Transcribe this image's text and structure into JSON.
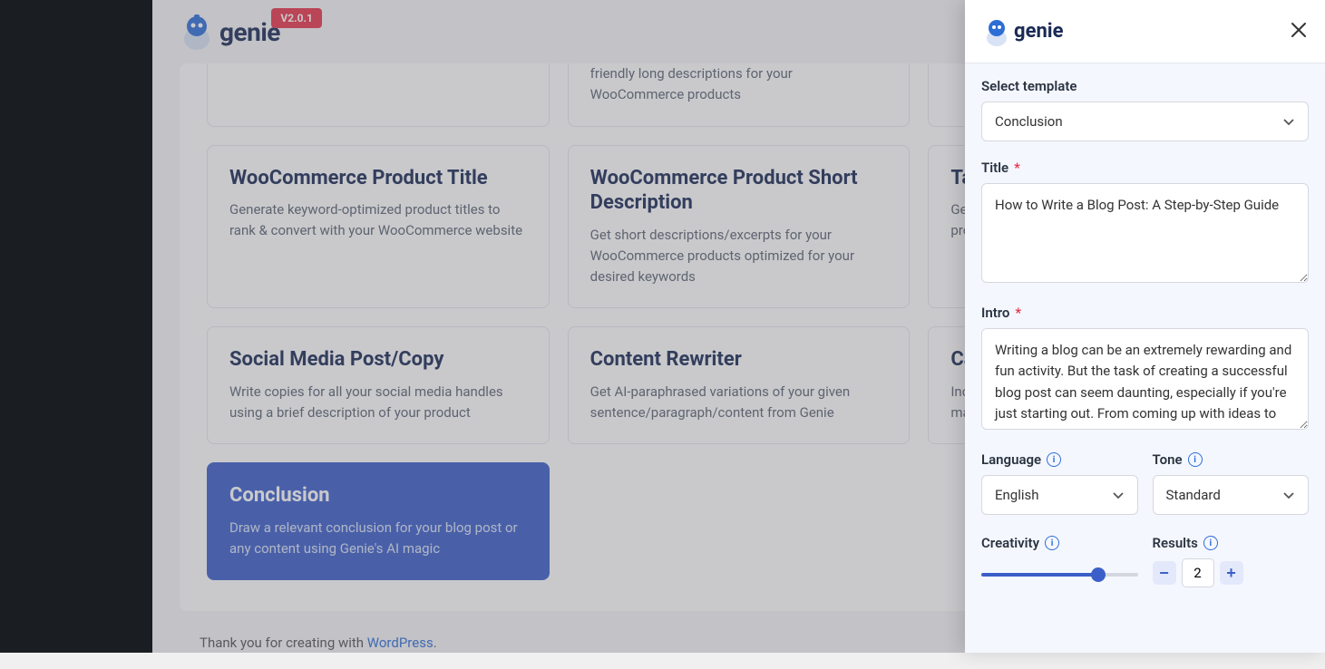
{
  "header": {
    "brand": "genie",
    "version": "V2.0.1"
  },
  "cards": {
    "row0": {
      "col1_desc": "friendly long descriptions for your WooCommerce products"
    },
    "row1": {
      "c0": {
        "title": "WooCommerce Product Title",
        "desc": "Generate keyword-optimized product titles to rank & convert with your WooCommerce website"
      },
      "c1": {
        "title": "WooCommerce Product Short Description",
        "desc": "Get short descriptions/excerpts for your WooCommerce products optimized for your desired keywords"
      },
      "c2": {
        "title_partial": "Tag",
        "desc_partial": "Get\nprod"
      }
    },
    "row2": {
      "c0": {
        "title": "Social Media Post/Copy",
        "desc": "Write copies for all your social media handles using a brief description of your product"
      },
      "c1": {
        "title": "Content Rewriter",
        "desc": "Get AI-paraphrased variations of your given sentence/paragraph/content from Genie"
      },
      "c2": {
        "title_partial": "Ca",
        "desc_partial": "Incr\nmag"
      }
    },
    "row3": {
      "c0": {
        "title": "Conclusion",
        "desc": "Draw a relevant conclusion for your blog post or any content using Genie's AI magic"
      }
    }
  },
  "footer": {
    "prefix": "Thank you for creating with ",
    "link": "WordPress",
    "suffix": "."
  },
  "panel": {
    "select_template_label": "Select template",
    "select_template_value": "Conclusion",
    "title_label": "Title",
    "title_value": "How to Write a Blog Post: A Step-by-Step Guide",
    "intro_label": "Intro",
    "intro_value": "Writing a blog can be an extremely rewarding and fun activity. But the task of creating a successful blog post can seem daunting, especially if you're just starting out. From coming up with ideas to",
    "language_label": "Language",
    "language_value": "English",
    "tone_label": "Tone",
    "tone_value": "Standard",
    "creativity_label": "Creativity",
    "results_label": "Results",
    "results_value": "2"
  }
}
